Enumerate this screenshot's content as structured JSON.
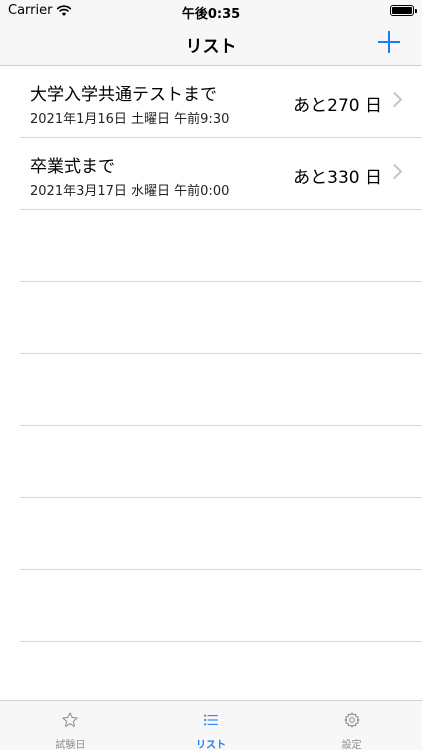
{
  "status_bar": {
    "carrier": "Carrier",
    "time": "午後0:35"
  },
  "nav": {
    "title": "リスト",
    "add_icon": "plus-icon",
    "accent": "#1a7cf5"
  },
  "items": [
    {
      "title": "大学入学共通テストまで",
      "date": "2021年1月16日 土曜日 午前9:30",
      "remaining": "あと270 日"
    },
    {
      "title": "卒業式まで",
      "date": "2021年3月17日 水曜日 午前0:00",
      "remaining": "あと330 日"
    }
  ],
  "tabs": [
    {
      "label": "試験日",
      "icon": "star-icon",
      "active": false
    },
    {
      "label": "リスト",
      "icon": "list-icon",
      "active": true
    },
    {
      "label": "設定",
      "icon": "gear-icon",
      "active": false
    }
  ]
}
